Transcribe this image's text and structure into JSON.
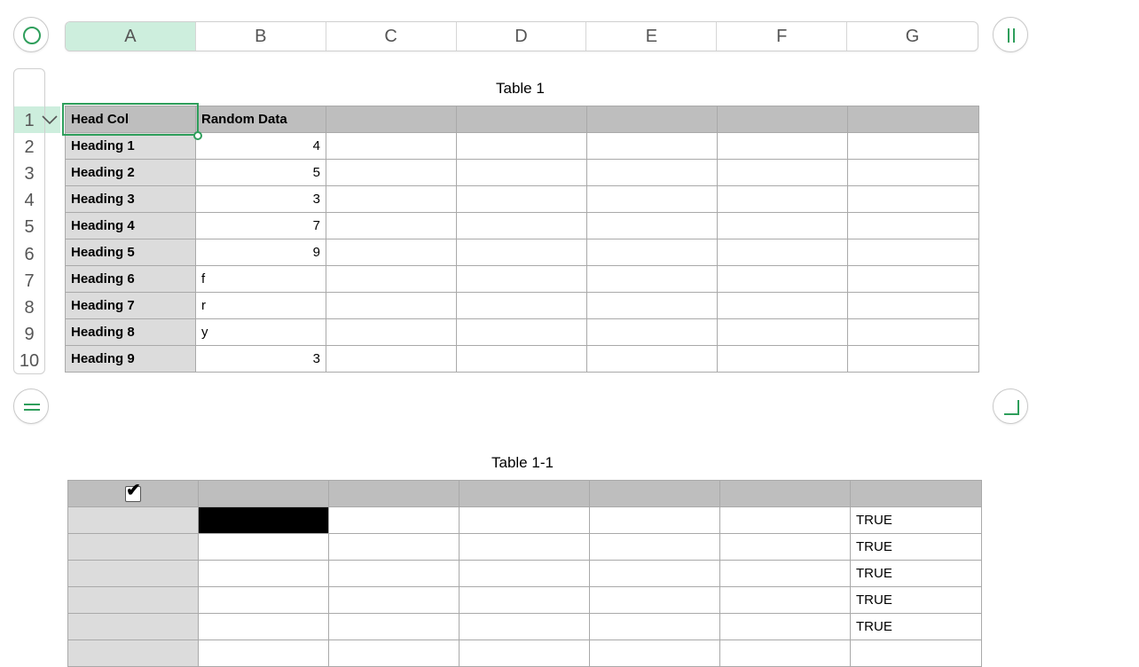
{
  "columns": [
    "A",
    "B",
    "C",
    "D",
    "E",
    "F",
    "G"
  ],
  "selected_column": "A",
  "rows": [
    "1",
    "2",
    "3",
    "4",
    "5",
    "6",
    "7",
    "8",
    "9",
    "10"
  ],
  "table1": {
    "title": "Table 1",
    "header": [
      "Head Col",
      "Random Data",
      "",
      "",
      "",
      "",
      ""
    ],
    "rows": [
      [
        "Heading 1",
        "4"
      ],
      [
        "Heading 2",
        "5"
      ],
      [
        "Heading 3",
        "3"
      ],
      [
        "Heading 4",
        "7"
      ],
      [
        "Heading 5",
        "9"
      ],
      [
        "Heading 6",
        "f"
      ],
      [
        "Heading 7",
        "r"
      ],
      [
        "Heading 8",
        "y"
      ],
      [
        "Heading 9",
        "3"
      ]
    ]
  },
  "table2": {
    "title": "Table 1-1",
    "checkbox_checked": true,
    "rows": [
      [
        "",
        "",
        "",
        "",
        "",
        "",
        "TRUE"
      ],
      [
        "",
        "",
        "",
        "",
        "",
        "",
        "TRUE"
      ],
      [
        "",
        "",
        "",
        "",
        "",
        "",
        "TRUE"
      ],
      [
        "",
        "",
        "",
        "",
        "",
        "",
        "TRUE"
      ],
      [
        "",
        "",
        "",
        "",
        "",
        "",
        "TRUE"
      ]
    ]
  },
  "icons": {
    "top_left": "select-table-circle-icon",
    "top_right": "pause-columns-icon",
    "bottom_left": "rows-equals-icon",
    "bottom_right": "resize-corner-icon"
  },
  "colors": {
    "accent": "#2e9e5b",
    "selection_fill": "#cdeedd",
    "header_gray": "#bebebe",
    "headcol_gray": "#dcdcdc"
  }
}
